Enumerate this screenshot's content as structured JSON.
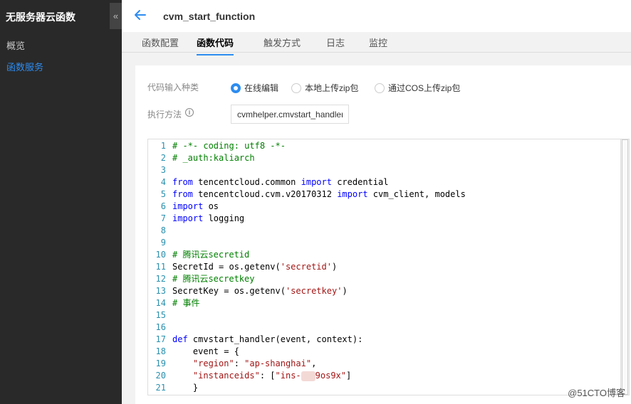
{
  "sidebar": {
    "title": "无服务器云函数",
    "collapse_label": "«",
    "items": [
      {
        "label": "概览",
        "active": false
      },
      {
        "label": "函数服务",
        "active": true
      }
    ]
  },
  "header": {
    "title": "cvm_start_function"
  },
  "tabs": [
    {
      "label": "函数配置",
      "active": false
    },
    {
      "label": "函数代码",
      "active": true
    },
    {
      "label": "触发方式",
      "active": false
    },
    {
      "label": "日志",
      "active": false
    },
    {
      "label": "监控",
      "active": false
    }
  ],
  "form": {
    "input_type_label": "代码输入种类",
    "options": [
      {
        "label": "在线编辑",
        "checked": true
      },
      {
        "label": "本地上传zip包",
        "checked": false
      },
      {
        "label": "通过COS上传zip包",
        "checked": false
      }
    ],
    "handler_label": "执行方法",
    "handler_value": "cvmhelper.cmvstart_handler"
  },
  "code": {
    "lines": [
      {
        "n": "1",
        "parts": [
          {
            "t": "# -*- coding: utf8 -*-",
            "c": "cm"
          }
        ]
      },
      {
        "n": "2",
        "parts": [
          {
            "t": "# _auth:kaliarch",
            "c": "cm"
          }
        ]
      },
      {
        "n": "3",
        "parts": []
      },
      {
        "n": "4",
        "parts": [
          {
            "t": "from",
            "c": "kw"
          },
          {
            "t": " tencentcloud.common ",
            "c": "tx"
          },
          {
            "t": "import",
            "c": "kw"
          },
          {
            "t": " credential",
            "c": "tx"
          }
        ]
      },
      {
        "n": "5",
        "parts": [
          {
            "t": "from",
            "c": "kw"
          },
          {
            "t": " tencentcloud.cvm.v20170312 ",
            "c": "tx"
          },
          {
            "t": "import",
            "c": "kw"
          },
          {
            "t": " cvm_client, models",
            "c": "tx"
          }
        ]
      },
      {
        "n": "6",
        "parts": [
          {
            "t": "import",
            "c": "kw"
          },
          {
            "t": " os",
            "c": "tx"
          }
        ]
      },
      {
        "n": "7",
        "parts": [
          {
            "t": "import",
            "c": "kw"
          },
          {
            "t": " logging",
            "c": "tx"
          }
        ]
      },
      {
        "n": "8",
        "parts": []
      },
      {
        "n": "9",
        "parts": []
      },
      {
        "n": "10",
        "parts": [
          {
            "t": "# 腾讯云secretid",
            "c": "cm"
          }
        ]
      },
      {
        "n": "11",
        "parts": [
          {
            "t": "SecretId = os.getenv(",
            "c": "tx"
          },
          {
            "t": "'secretid'",
            "c": "st"
          },
          {
            "t": ")",
            "c": "tx"
          }
        ]
      },
      {
        "n": "12",
        "parts": [
          {
            "t": "# 腾讯云secretkey",
            "c": "cm"
          }
        ]
      },
      {
        "n": "13",
        "parts": [
          {
            "t": "SecretKey = os.getenv(",
            "c": "tx"
          },
          {
            "t": "'secretkey'",
            "c": "st"
          },
          {
            "t": ")",
            "c": "tx"
          }
        ]
      },
      {
        "n": "14",
        "parts": [
          {
            "t": "# 事件",
            "c": "cm"
          }
        ]
      },
      {
        "n": "15",
        "parts": []
      },
      {
        "n": "16",
        "parts": []
      },
      {
        "n": "17",
        "parts": [
          {
            "t": "def",
            "c": "kw"
          },
          {
            "t": " cmvstart_handler(event, context):",
            "c": "tx"
          }
        ]
      },
      {
        "n": "18",
        "parts": [
          {
            "t": "    event = {",
            "c": "tx"
          }
        ]
      },
      {
        "n": "19",
        "parts": [
          {
            "t": "    ",
            "c": "tx"
          },
          {
            "t": "\"region\"",
            "c": "st"
          },
          {
            "t": ": ",
            "c": "tx"
          },
          {
            "t": "\"ap-shanghai\"",
            "c": "st"
          },
          {
            "t": ",",
            "c": "tx"
          }
        ]
      },
      {
        "n": "20",
        "parts": [
          {
            "t": "    ",
            "c": "tx"
          },
          {
            "t": "\"instanceids\"",
            "c": "st"
          },
          {
            "t": ": [",
            "c": "tx"
          },
          {
            "t": "\"ins-",
            "c": "st"
          },
          {
            "t": "",
            "c": "blur"
          },
          {
            "t": "9os9x\"",
            "c": "st"
          },
          {
            "t": "]",
            "c": "tx"
          }
        ]
      },
      {
        "n": "21",
        "parts": [
          {
            "t": "    }",
            "c": "tx"
          }
        ]
      }
    ]
  },
  "watermark": "@51CTO博客"
}
